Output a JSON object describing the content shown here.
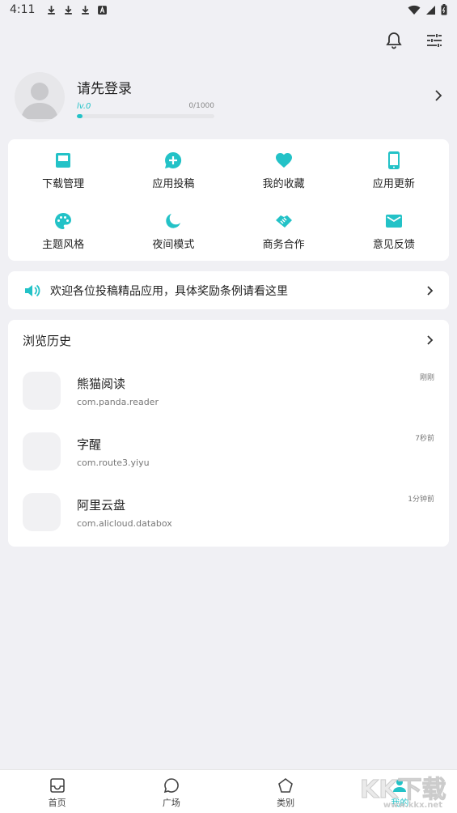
{
  "status_bar": {
    "time": "4:11"
  },
  "profile": {
    "login_text": "请先登录",
    "level": "lv.0",
    "exp": "0/1000",
    "exp_fraction": 0.04
  },
  "menu": [
    {
      "label": "下载管理",
      "icon": "inbox-icon"
    },
    {
      "label": "应用投稿",
      "icon": "add-comment-icon"
    },
    {
      "label": "我的收藏",
      "icon": "heart-icon"
    },
    {
      "label": "应用更新",
      "icon": "phone-icon"
    },
    {
      "label": "主题风格",
      "icon": "palette-icon"
    },
    {
      "label": "夜间模式",
      "icon": "moon-icon"
    },
    {
      "label": "商务合作",
      "icon": "handshake-icon"
    },
    {
      "label": "意见反馈",
      "icon": "mail-icon"
    }
  ],
  "notice": {
    "text": "欢迎各位投稿精品应用，具体奖励条例请看这里"
  },
  "history": {
    "title": "浏览历史",
    "items": [
      {
        "name": "熊猫阅读",
        "package": "com.panda.reader",
        "time": "刚刚"
      },
      {
        "name": "字醒",
        "package": "com.route3.yiyu",
        "time": "7秒前"
      },
      {
        "name": "阿里云盘",
        "package": "com.alicloud.databox",
        "time": "1分钟前"
      }
    ]
  },
  "bottom_nav": [
    {
      "label": "首页",
      "icon": "home-inbox-icon"
    },
    {
      "label": "广场",
      "icon": "chat-bubble-icon"
    },
    {
      "label": "类别",
      "icon": "pentagon-icon"
    },
    {
      "label": "我的",
      "icon": "person-icon",
      "active": true
    }
  ],
  "watermark": {
    "big": "KK下载",
    "small": "www.kkx.net"
  },
  "colors": {
    "accent": "#23c2c7",
    "background": "#f0f0f4"
  }
}
